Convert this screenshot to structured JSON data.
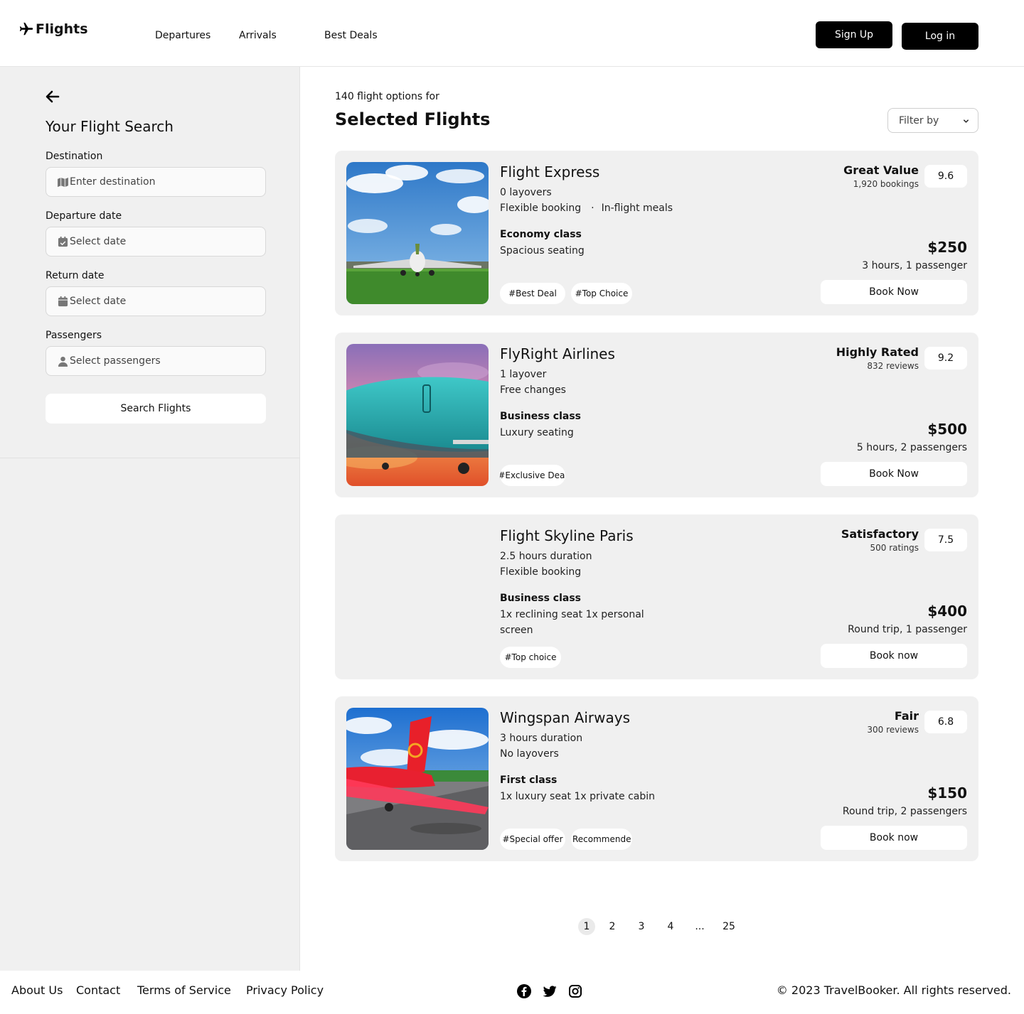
{
  "header": {
    "brand": "Flights",
    "nav": [
      "Departures",
      "Arrivals",
      "Best Deals"
    ],
    "signup_label": "Sign Up",
    "login_label": "Log in"
  },
  "sidebar": {
    "title": "Your Flight Search",
    "fields": [
      {
        "label": "Destination",
        "placeholder": "Enter destination",
        "icon": "map-icon"
      },
      {
        "label": "Departure date",
        "placeholder": "Select date",
        "icon": "calendar-check-icon"
      },
      {
        "label": "Return date",
        "placeholder": "Select date",
        "icon": "calendar-icon"
      },
      {
        "label": "Passengers",
        "placeholder": "Select passengers",
        "icon": "user-icon"
      }
    ],
    "search_label": "Search Flights"
  },
  "main": {
    "count_text": "140 flight options for",
    "title": "Selected Flights",
    "filter_label": "Filter by"
  },
  "flights": [
    {
      "name": "Flight Express",
      "line1": "0 layovers",
      "line2a": "Flexible booking",
      "line2b": "In-flight meals",
      "class": "Economy class",
      "class_desc": "Spacious seating",
      "class_desc2": "",
      "tags": [
        "#Best Deal",
        "#Top Choice"
      ],
      "rating_label": "Great Value",
      "rating_sub": "1,920 bookings",
      "score": "9.6",
      "price": "$250",
      "price_sub": "3 hours, 1 passenger",
      "book_label": "Book Now"
    },
    {
      "name": "FlyRight Airlines",
      "line1": "1 layover",
      "line2a": "Free changes",
      "line2b": "",
      "class": "Business class",
      "class_desc": "Luxury seating",
      "class_desc2": "",
      "tags": [
        "#Exclusive Deal"
      ],
      "rating_label": "Highly Rated",
      "rating_sub": "832 reviews",
      "score": "9.2",
      "price": "$500",
      "price_sub": "5 hours, 2 passengers",
      "book_label": "Book Now"
    },
    {
      "name": "Flight Skyline Paris",
      "line1": "2.5 hours duration",
      "line2a": "Flexible booking",
      "line2b": "",
      "class": "Business class",
      "class_desc": "1x reclining seat 1x personal",
      "class_desc2": "screen",
      "tags": [
        "#Top choice"
      ],
      "rating_label": "Satisfactory",
      "rating_sub": "500 ratings",
      "score": "7.5",
      "price": "$400",
      "price_sub": "Round trip, 1 passenger",
      "book_label": "Book now"
    },
    {
      "name": "Wingspan Airways",
      "line1": "3 hours duration",
      "line2a": "No layovers",
      "line2b": "",
      "class": "First class",
      "class_desc": "1x luxury seat 1x private cabin",
      "class_desc2": "",
      "tags": [
        "#Special offer",
        "Recommende"
      ],
      "rating_label": "Fair",
      "rating_sub": "300 reviews",
      "score": "6.8",
      "price": "$150",
      "price_sub": "Round trip, 2 passengers",
      "book_label": "Book now"
    }
  ],
  "pagination": {
    "pages": [
      "1",
      "2",
      "3",
      "4",
      "...",
      "25"
    ],
    "current": "1"
  },
  "footer": {
    "links": [
      "About Us",
      "Contact",
      "Terms of Service",
      "Privacy Policy"
    ],
    "social_icons": [
      "facebook-icon",
      "twitter-icon",
      "instagram-icon"
    ],
    "copyright": "© 2023 TravelBooker. All rights reserved."
  }
}
